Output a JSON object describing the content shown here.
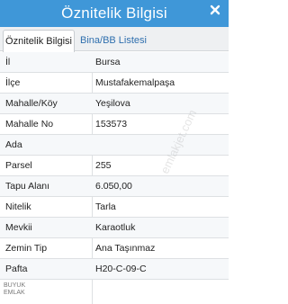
{
  "window": {
    "title": "Öznitelik Bilgisi",
    "close_icon": "close-icon"
  },
  "tabs": [
    {
      "label": "Öznitelik Bilgisi",
      "active": true
    },
    {
      "label": "Bina/BB Listesi",
      "active": false
    }
  ],
  "rows": [
    {
      "label": "İl",
      "value": "Bursa"
    },
    {
      "label": "İlçe",
      "value": "Mustafakemalpaşa"
    },
    {
      "label": "Mahalle/Köy",
      "value": "Yeşilova"
    },
    {
      "label": "Mahalle No",
      "value": "153573"
    },
    {
      "label": "Ada",
      "value": ""
    },
    {
      "label": "Parsel",
      "value": "255"
    },
    {
      "label": "Tapu Alanı",
      "value": "6.050,00"
    },
    {
      "label": "Nitelik",
      "value": "Tarla"
    },
    {
      "label": "Mevkii",
      "value": "Karaotluk"
    },
    {
      "label": "Zemin Tip",
      "value": "Ana Taşınmaz"
    },
    {
      "label": "Pafta",
      "value": "H20-C-09-C"
    }
  ],
  "watermark": "emlakjet.com",
  "logo": {
    "line1": "BUYUK",
    "line2": "EMLAK"
  },
  "colors": {
    "header": "#3f97d8",
    "tab_bar": "#eef0f2"
  }
}
